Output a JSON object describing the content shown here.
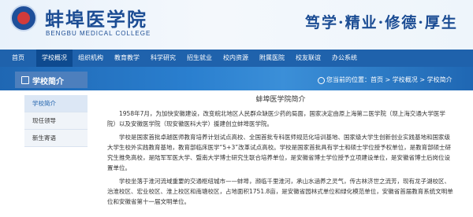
{
  "header": {
    "school_name": "蚌埠医学院",
    "school_name_en": "BENGBU MEDICAL COLLEGE",
    "motto": "笃学·精业·修德·厚生"
  },
  "nav": {
    "items": [
      "首页",
      "学校概况",
      "组织机构",
      "教育教学",
      "科学研究",
      "招生就业",
      "校内资源",
      "附属医院",
      "校友联谊",
      "办公系统"
    ]
  },
  "sidebar": {
    "title": "学校简介",
    "items": [
      "学校简介",
      "现任领导",
      "新生寄语"
    ]
  },
  "breadcrumb": {
    "text": "您当前的位置：首页 > 学校概况 > 学校简介"
  },
  "article": {
    "title": "蚌埠医学院简介",
    "paragraphs": [
      "1958年7月，为加快安徽建设，改变皖北地区人民群众缺医少药的局面，国家决定由原上海第二医学院（现上海交通大学医学院）以及安徽医学院（现安徽医科大学）援建创立蚌埠医学院。",
      "学校是国家首批卓越医师教育培养计划试点高校、全国首批专科医师规范化培训基地、国家级大学生创新创业实践基地和国家级大学生校外实践教育基地，教育部临床医学“5+3”改革试点高校。学校是国家首批具有学士和硕士学位授予权单位，是教育部硕士研究生推免高校，是陆军军医大学、暨南大学博士研究生联合培养单位，是安徽省博士学位授予立项建设单位，是安徽省博士后岗位设置单位。",
      "学校坐落于淮河流域重要的交通枢纽城市——蚌埠，濒临千里淮河，承山水涵养之灵气，传古林济世之流芳，现有龙子湖校区、治淮校区、宏业校区、淮上校区和南塘校区，占地面积1751.8亩，是安徽省园林式单位和绿化模范单位，安徽省首届教育系统文明单位和安徽省第十一届文明单位。"
    ]
  }
}
